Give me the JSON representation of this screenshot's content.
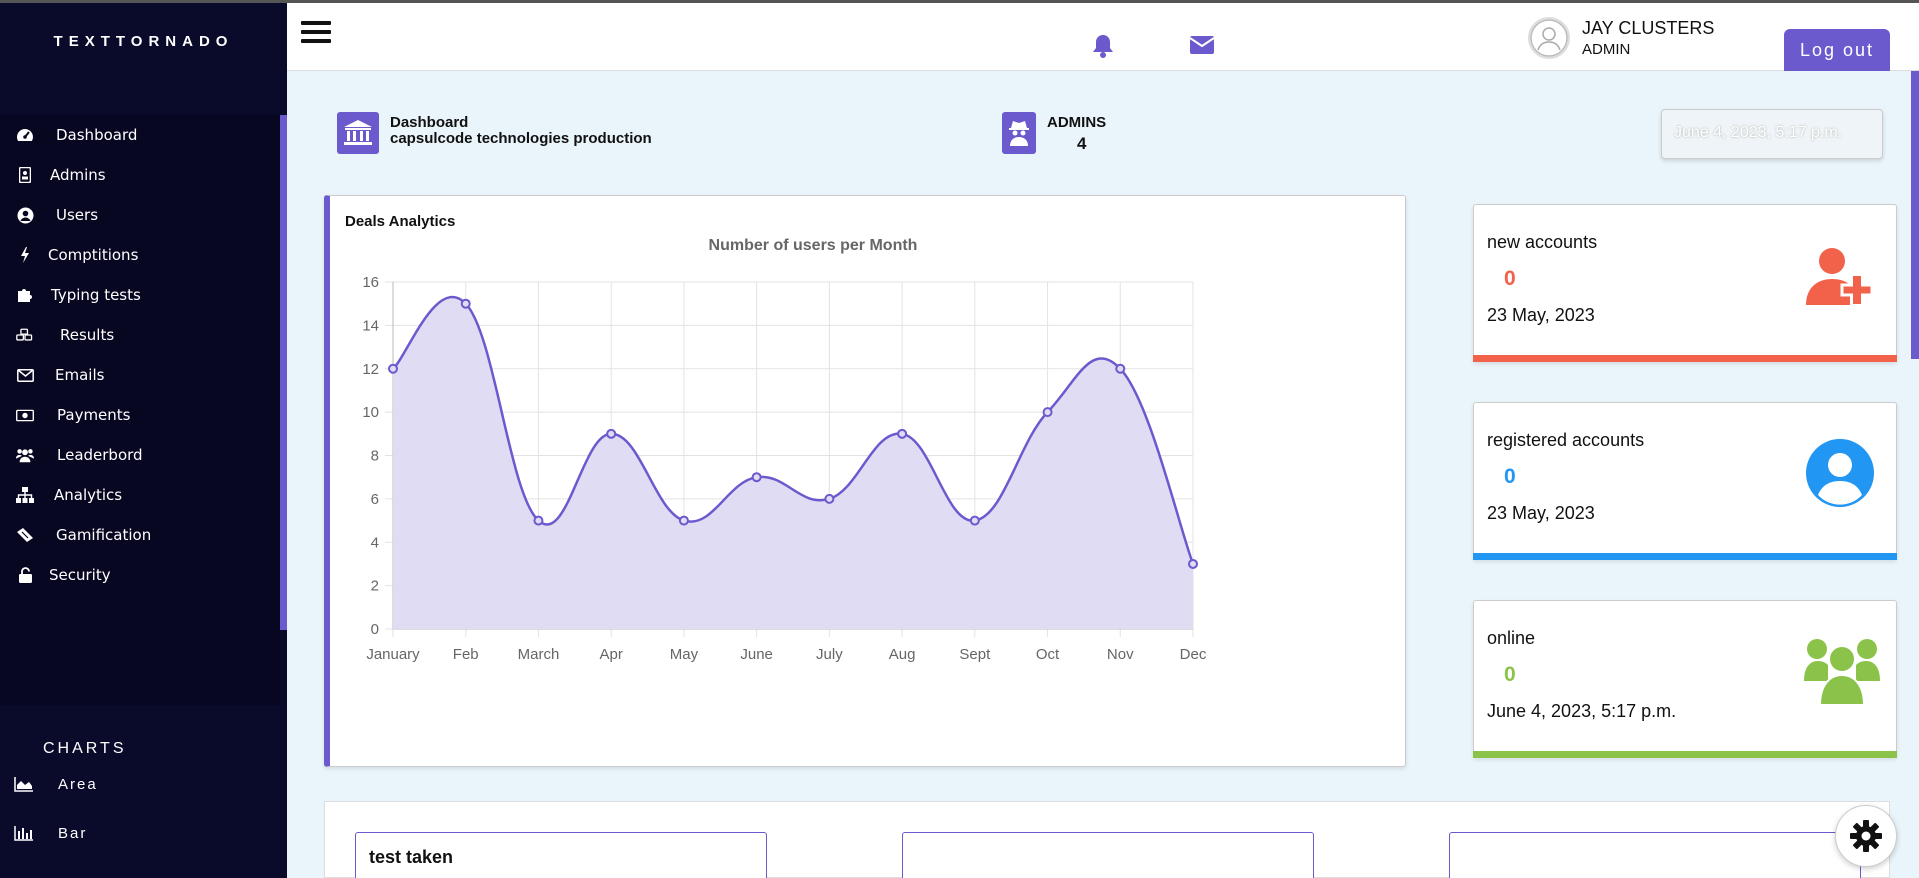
{
  "app": {
    "brand": "TEXTTORNADO"
  },
  "sidebar": {
    "items": [
      {
        "label": "Dashboard",
        "icon": "tachometer-icon"
      },
      {
        "label": "Admins",
        "icon": "id-badge-icon"
      },
      {
        "label": "Users",
        "icon": "user-circle-icon"
      },
      {
        "label": "Comptitions",
        "icon": "bolt-icon"
      },
      {
        "label": "Typing tests",
        "icon": "puzzle-icon"
      },
      {
        "label": "Results",
        "icon": "cubes-icon"
      },
      {
        "label": "Emails",
        "icon": "envelope-icon"
      },
      {
        "label": "Payments",
        "icon": "money-icon"
      },
      {
        "label": "Leaderbord",
        "icon": "users-icon"
      },
      {
        "label": "Analytics",
        "icon": "sitemap-icon"
      },
      {
        "label": "Gamification",
        "icon": "ticket-icon"
      },
      {
        "label": "Security",
        "icon": "unlock-icon"
      }
    ],
    "charts_title": "CHARTS",
    "chart_items": [
      {
        "label": "Area",
        "icon": "area-chart-icon"
      },
      {
        "label": "Bar",
        "icon": "bar-chart-icon"
      }
    ]
  },
  "header": {
    "user_name": "JAY CLUSTERS",
    "user_role": "ADMIN",
    "logout_label": "Log out"
  },
  "info": {
    "dashboard_title": "Dashboard",
    "dashboard_subtitle": "capsulcode technologies production",
    "admins_label": "ADMINS",
    "admins_count": "4",
    "datetime": "June 4, 2023, 5:17 p.m."
  },
  "chart_card": {
    "title": "Deals Analytics"
  },
  "chart_data": {
    "type": "area",
    "title": "Number of users per Month",
    "categories": [
      "January",
      "Feb",
      "March",
      "Apr",
      "May",
      "June",
      "July",
      "Aug",
      "Sept",
      "Oct",
      "Nov",
      "Dec"
    ],
    "values": [
      12,
      15,
      5,
      9,
      5,
      7,
      6,
      9,
      5,
      10,
      12,
      3
    ],
    "ylim": [
      0,
      16
    ],
    "yticks": [
      0,
      2,
      4,
      6,
      8,
      10,
      12,
      14,
      16
    ],
    "grid": true,
    "line_color": "#6a5acd",
    "fill_color": "#e0dcf4"
  },
  "stats": [
    {
      "title": "new accounts",
      "value": "0",
      "date": "23 May, 2023",
      "color": "#f2624a",
      "icon": "user-plus-icon"
    },
    {
      "title": "registered accounts",
      "value": "0",
      "date": "23 May, 2023",
      "color": "#2196f3",
      "icon": "user-circle-icon"
    },
    {
      "title": "online",
      "value": "0",
      "date": "June 4, 2023, 5:17 p.m.",
      "color": "#8bc34a",
      "icon": "users-icon"
    }
  ],
  "bottom": {
    "test_taken": "test taken"
  },
  "colors": {
    "accent": "#6a5acd",
    "sidebar_bg": "#0a0a2a"
  }
}
